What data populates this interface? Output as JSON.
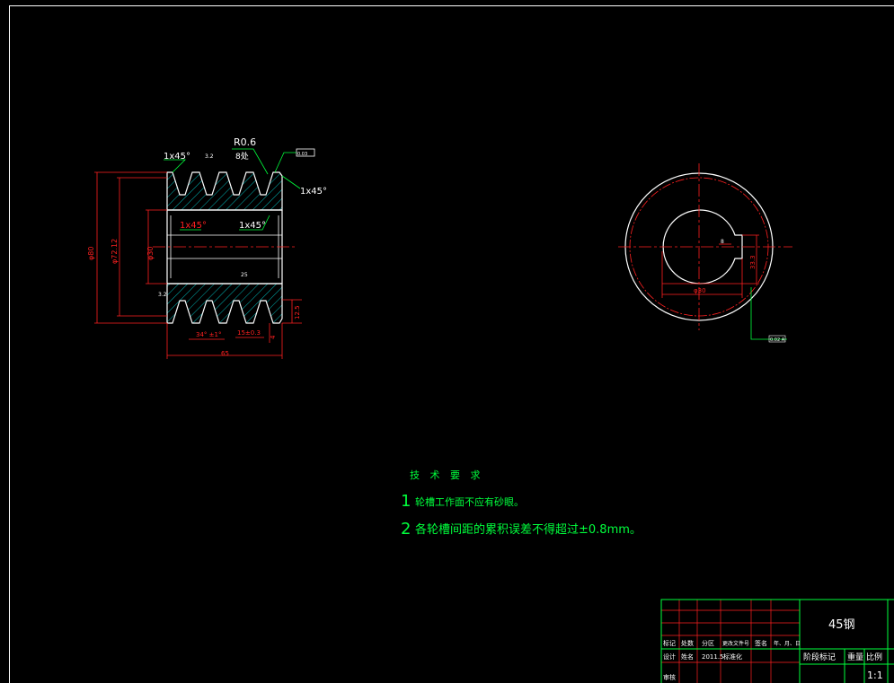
{
  "drawing": {
    "colors": {
      "background": "#000000",
      "outline": "#ffffff",
      "dimension": "#ff2020",
      "hatch": "#00c8c8",
      "leader": "#00ff3c",
      "text_green": "#00ff3c",
      "text_white": "#ffffff"
    },
    "front_view": {
      "chamfer_top_left": "1x45°",
      "chamfer_top_right": "1x45°",
      "chamfer_inner_left": "1x45°",
      "chamfer_inner_right": "1x45°",
      "groove_radius": "R0.6",
      "groove_count": "8处",
      "surface_mark_top": "3.2",
      "surface_mark_bottom": "3.2",
      "surface_mark_bore": "25",
      "tolerance_box": "0.03",
      "groove_angle_dim": "34° ±1°",
      "pitch_dim": "15±0.3",
      "groove_depth_dim": "4",
      "edge_dim": "12.5",
      "width_dim": "65",
      "od_dim": "φ80",
      "groove_dia_dim": "φ72.12",
      "bore_dim": "φ30"
    },
    "side_view": {
      "keyway_width": "8",
      "keyway_depth": "33.3",
      "bore_label": "φ30",
      "leader_label": "0.02 A"
    },
    "tech_requirements": {
      "title": "技 术 要 求",
      "items": [
        {
          "num": "1",
          "text": "轮槽工作面不应有砂眼。"
        },
        {
          "num": "2",
          "text": "各轮槽间距的累积误差不得超过±0.8mm。"
        }
      ]
    },
    "title_block": {
      "material": "45钢",
      "row1": [
        "标记",
        "处数",
        "分区",
        "更改文件号",
        "签名",
        "年、月、日"
      ],
      "row2": [
        "设计",
        "姓名",
        "2011.5",
        "标准化"
      ],
      "row3": [
        "审核"
      ],
      "stage_label": "阶段标记",
      "weight_label": "重量",
      "scale_label": "比例",
      "scale_value": "1:1"
    }
  }
}
